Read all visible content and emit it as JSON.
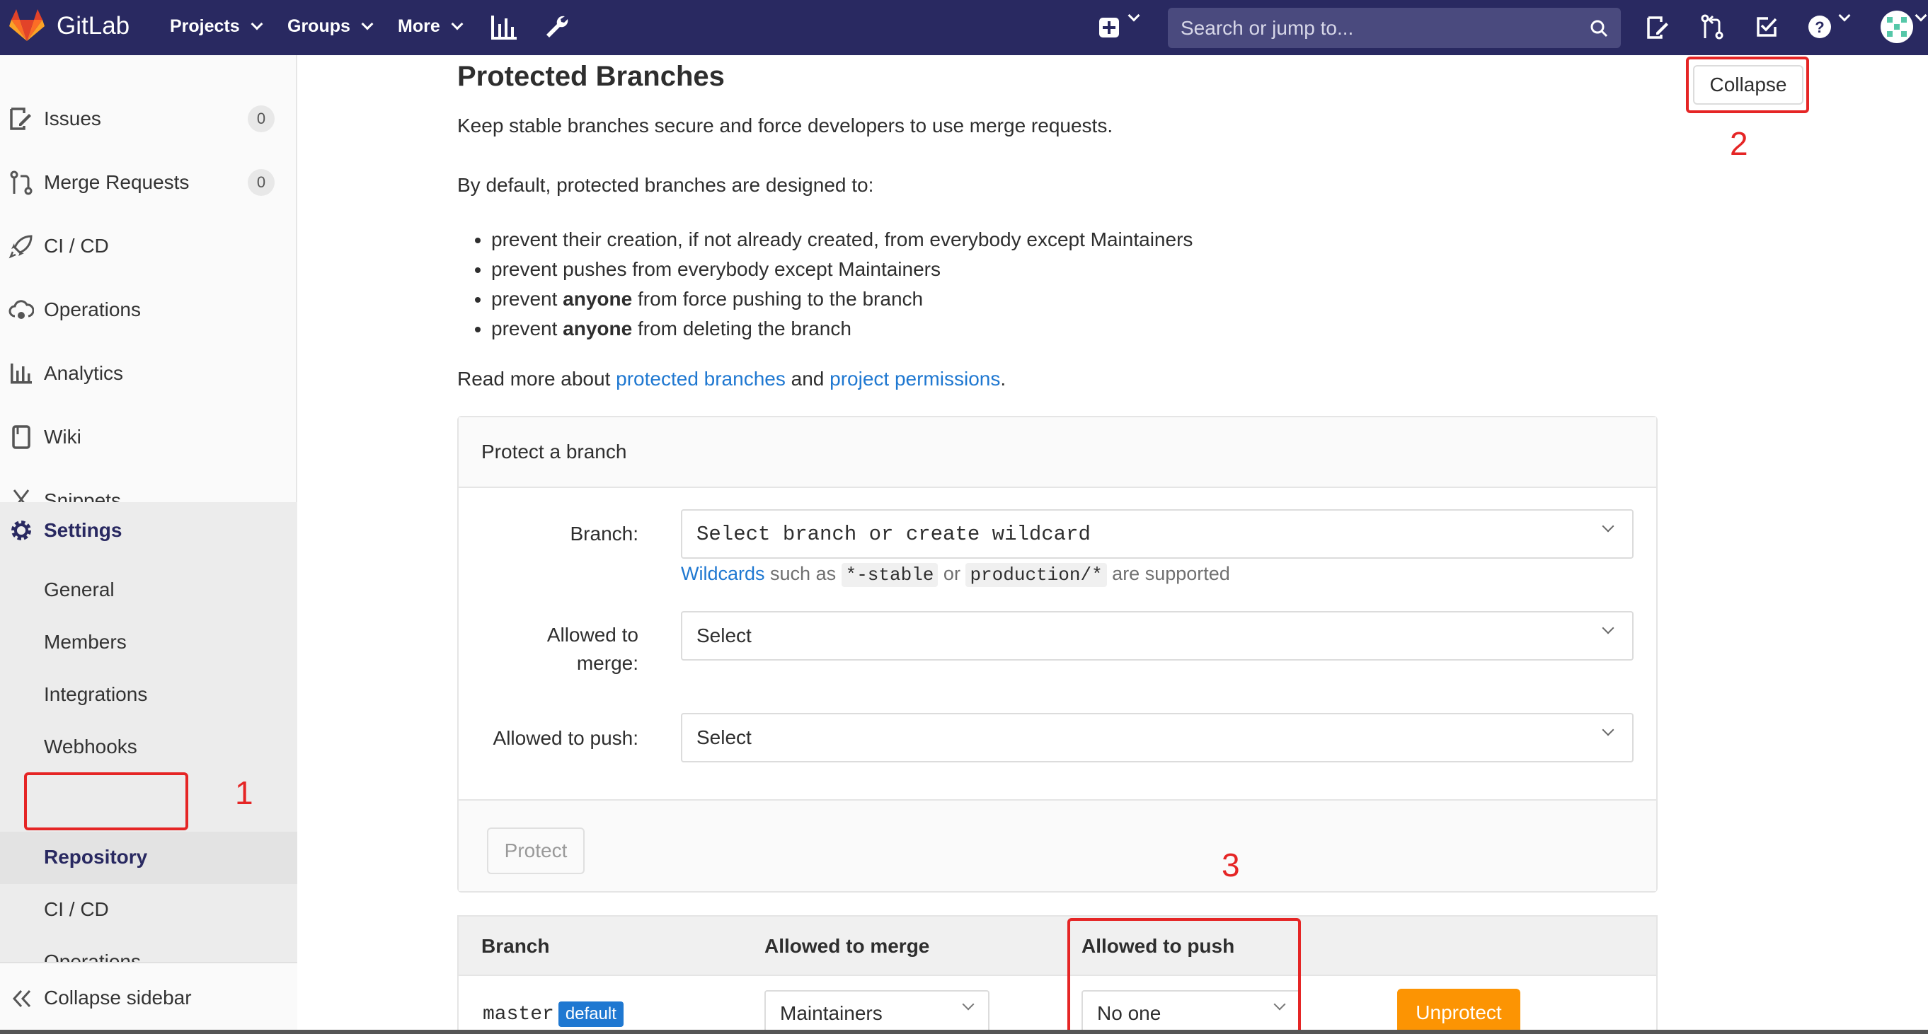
{
  "navbar": {
    "brand": "GitLab",
    "menus": [
      "Projects",
      "Groups",
      "More"
    ],
    "search_placeholder": "Search or jump to..."
  },
  "sidebar": {
    "items": [
      {
        "label": "Issues",
        "count": "0"
      },
      {
        "label": "Merge Requests",
        "count": "0"
      },
      {
        "label": "CI / CD"
      },
      {
        "label": "Operations"
      },
      {
        "label": "Analytics"
      },
      {
        "label": "Wiki"
      },
      {
        "label": "Snippets"
      },
      {
        "label": "Settings"
      }
    ],
    "settings_sub": [
      "General",
      "Members",
      "Integrations",
      "Webhooks",
      "Repository",
      "CI / CD",
      "Operations"
    ],
    "collapse_label": "Collapse sidebar"
  },
  "page": {
    "title": "Protected Branches",
    "collapse_label": "Collapse",
    "intro": "Keep stable branches secure and force developers to use merge requests.",
    "default_intro": "By default, protected branches are designed to:",
    "bullets": [
      {
        "pre": "prevent their creation, if not already created, from everybody except Maintainers",
        "bold": "",
        "post": ""
      },
      {
        "pre": "prevent pushes from everybody except Maintainers",
        "bold": "",
        "post": ""
      },
      {
        "pre": "prevent ",
        "bold": "anyone",
        "post": " from force pushing to the branch"
      },
      {
        "pre": "prevent ",
        "bold": "anyone",
        "post": " from deleting the branch"
      }
    ],
    "read_more": {
      "pre": "Read more about ",
      "link1": "protected branches",
      "mid": " and ",
      "link2": "project permissions",
      "post": "."
    }
  },
  "protect_form": {
    "title": "Protect a branch",
    "branch_label": "Branch:",
    "branch_placeholder": "Select branch or create wildcard",
    "hint": {
      "link": "Wildcards",
      "t1": " such as ",
      "code1": "*-stable",
      "t2": " or ",
      "code2": "production/*",
      "t3": " are supported"
    },
    "merge_label_1": "Allowed to",
    "merge_label_2": "merge:",
    "merge_value": "Select",
    "push_label": "Allowed to push:",
    "push_value": "Select",
    "protect_button": "Protect"
  },
  "table": {
    "headers": [
      "Branch",
      "Allowed to merge",
      "Allowed to push"
    ],
    "rows": [
      {
        "branch": "master",
        "badge": "default",
        "merge": "Maintainers",
        "push": "No one",
        "action": "Unprotect"
      }
    ]
  },
  "annotations": [
    "1",
    "2",
    "3"
  ],
  "colors": {
    "navbar": "#292961",
    "link": "#1f78d1",
    "unprotect": "#fc9403",
    "annotation": "#e52525"
  }
}
